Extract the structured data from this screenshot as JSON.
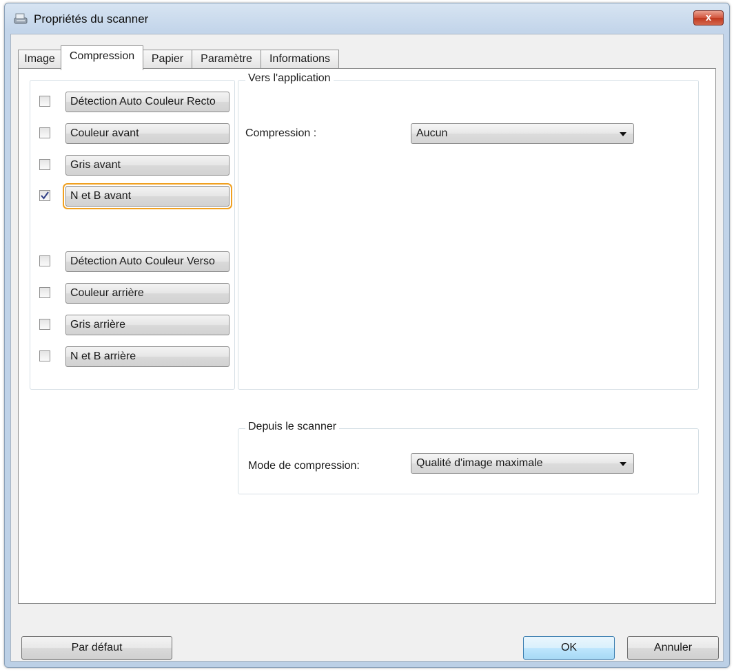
{
  "window": {
    "title": "Propriétés du scanner",
    "close_label": "x"
  },
  "tabs": [
    {
      "label": "Image",
      "active": false
    },
    {
      "label": "Compression",
      "active": true
    },
    {
      "label": "Papier",
      "active": false
    },
    {
      "label": "Paramètre",
      "active": false
    },
    {
      "label": "Informations",
      "active": false
    }
  ],
  "image_options": [
    {
      "label": "Détection Auto Couleur Recto",
      "checked": false
    },
    {
      "label": "Couleur avant",
      "checked": false
    },
    {
      "label": "Gris avant",
      "checked": false
    },
    {
      "label": "N et B avant",
      "checked": true
    },
    {
      "label": "Détection Auto Couleur Verso",
      "checked": false
    },
    {
      "label": "Couleur arrière",
      "checked": false
    },
    {
      "label": "Gris arrière",
      "checked": false
    },
    {
      "label": "N et B arrière",
      "checked": false
    }
  ],
  "vers_application": {
    "legend": "Vers l'application",
    "compression_label": "Compression :",
    "compression_value": "Aucun"
  },
  "depuis_scanner": {
    "legend": "Depuis le scanner",
    "mode_label": "Mode de compression:",
    "mode_value": "Qualité d'image maximale"
  },
  "buttons": {
    "default": "Par défaut",
    "ok": "OK",
    "cancel": "Annuler"
  },
  "colors": {
    "focus_ring": "#f0a020",
    "close_button": "#c94a33"
  },
  "icons": {
    "title": "scanner-icon",
    "close": "close-icon",
    "check": "check-icon",
    "dropdown": "chevron-down-icon"
  }
}
